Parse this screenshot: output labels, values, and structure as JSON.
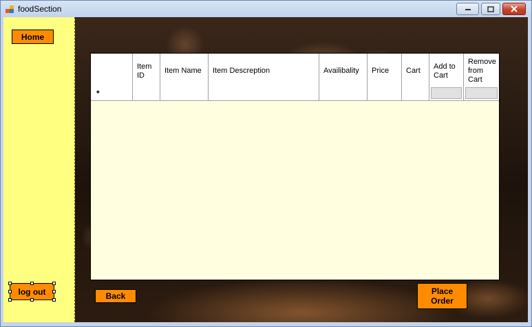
{
  "window": {
    "title": "foodSection"
  },
  "sidebar": {
    "home_label": "Home",
    "logout_label": "log out"
  },
  "grid": {
    "columns": [
      "",
      "Item ID",
      "Item Name",
      "Item Descreption",
      "Availibality",
      "Price",
      "Cart",
      "Add to Cart",
      "Remove from Cart"
    ],
    "new_row_marker": "*"
  },
  "actions": {
    "back_label": "Back",
    "place_order_line1": "Place",
    "place_order_line2": "Order"
  },
  "colors": {
    "sidebar": "#ffff80",
    "button": "#ff8c00",
    "grid_background": "#ffffe0"
  }
}
